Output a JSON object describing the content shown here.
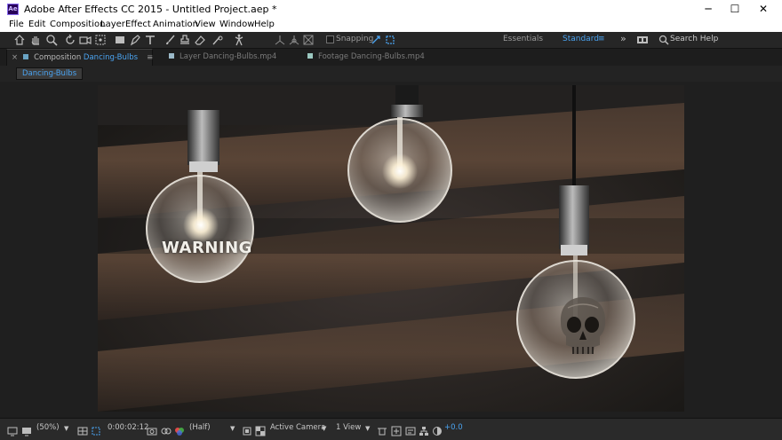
{
  "window": {
    "app_icon_text": "Ae",
    "title": "Adobe After Effects CC 2015 - Untitled Project.aep *",
    "minimize": "─",
    "maximize": "☐",
    "close": "✕"
  },
  "menu": [
    "File",
    "Edit",
    "Composition",
    "Layer",
    "Effect",
    "Animation",
    "View",
    "Window",
    "Help"
  ],
  "toolbar": {
    "snapping_label": "Snapping",
    "workspace_essentials": "Essentials",
    "workspace_standard": "Standard",
    "workspace_menu": "≡",
    "more": "»",
    "search_label": "Search Help"
  },
  "tabs": {
    "composition_close": "×",
    "composition_prefix": "Composition",
    "composition_name": "Dancing-Bulbs",
    "composition_menu": "≡",
    "layer_label": "Layer Dancing-Bulbs.mp4",
    "footage_label": "Footage Dancing-Bulbs.mp4"
  },
  "comp_pill": "Dancing-Bulbs",
  "viewer": {
    "overlay_text": "WARNING",
    "icon_name": "skull-icon"
  },
  "status": {
    "zoom": "(50%)",
    "timecode": "0:00:02:12",
    "resolution": "(Half)",
    "camera": "Active Camera",
    "views": "1 View",
    "exposure": "+0.0"
  },
  "colors": {
    "accent": "#4aa3f0",
    "panel": "#232323",
    "status_green": "#5fd46a"
  }
}
